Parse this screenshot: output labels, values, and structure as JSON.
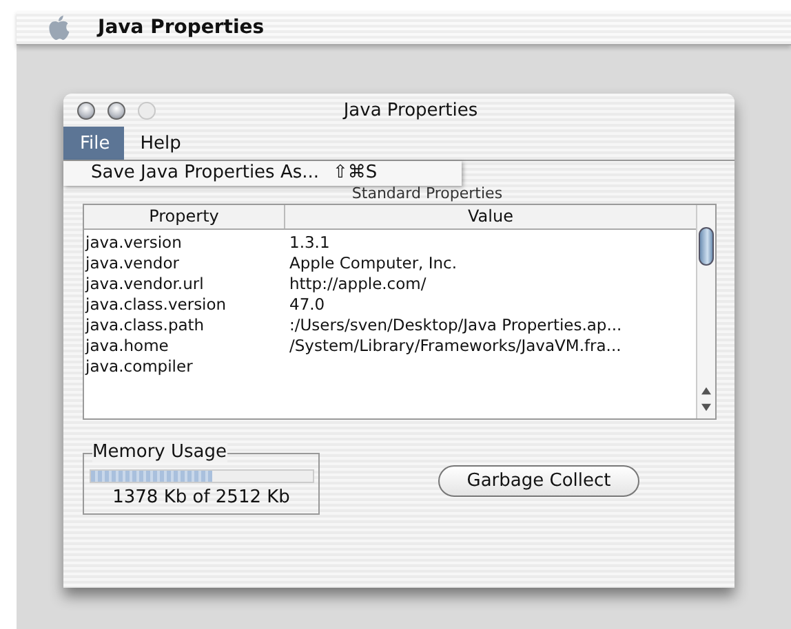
{
  "menubar": {
    "app_name": "Java Properties"
  },
  "window": {
    "title": "Java Properties"
  },
  "menu": [
    {
      "label": "File",
      "selected": true
    },
    {
      "label": "Help",
      "selected": false
    }
  ],
  "dropdown": {
    "items": [
      {
        "label": "Save Java Properties As...",
        "shortcut": "⇧⌘S"
      }
    ]
  },
  "tab_label": "Standard Properties",
  "table": {
    "columns": [
      "Property",
      "Value"
    ],
    "rows": [
      {
        "property": "java.version",
        "value": "1.3.1"
      },
      {
        "property": "java.vendor",
        "value": "Apple Computer, Inc."
      },
      {
        "property": "java.vendor.url",
        "value": "http://apple.com/"
      },
      {
        "property": "java.class.version",
        "value": "47.0"
      },
      {
        "property": "java.class.path",
        "value": ":/Users/sven/Desktop/Java Properties.ap..."
      },
      {
        "property": "java.home",
        "value": "/System/Library/Frameworks/JavaVM.fra..."
      },
      {
        "property": "java.compiler"
      }
    ]
  },
  "memory": {
    "title": "Memory Usage",
    "level": 0.55,
    "reading": "1378 Kb of 2512 Kb"
  },
  "buttons": [
    {
      "label": "Garbage Collect"
    }
  ]
}
